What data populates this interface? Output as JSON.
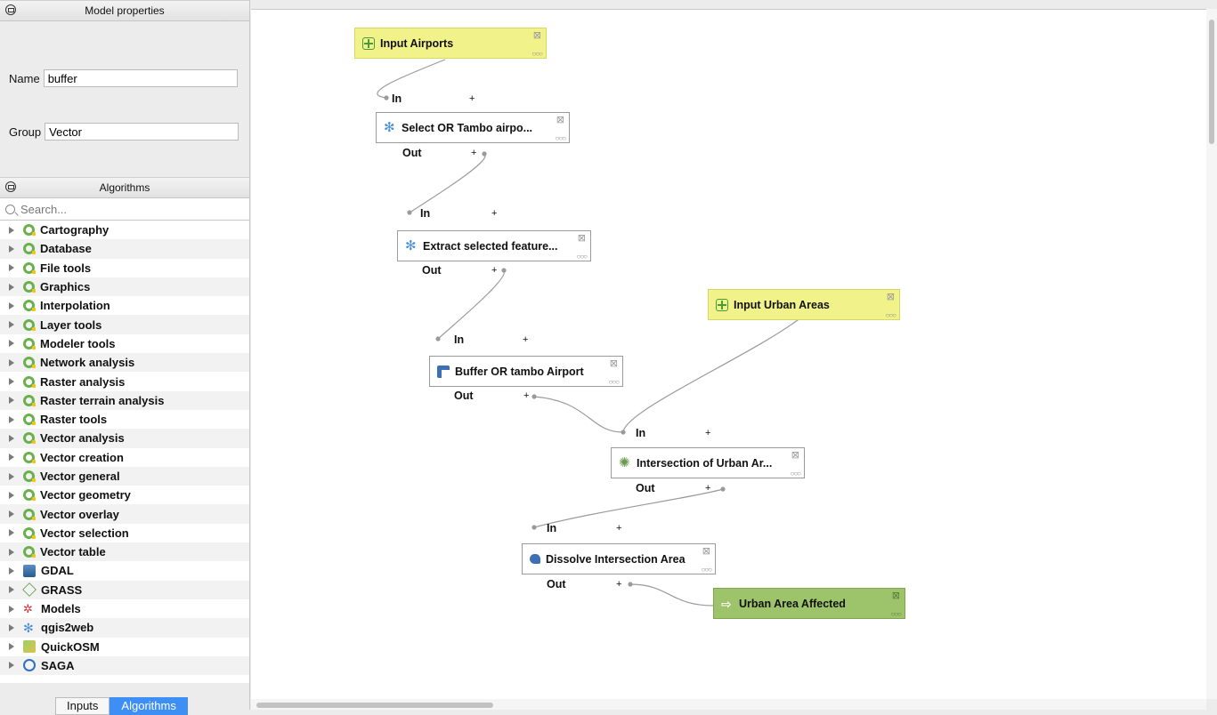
{
  "properties_panel": {
    "title": "Model properties",
    "name_label": "Name",
    "name_value": "buffer",
    "group_label": "Group",
    "group_value": "Vector"
  },
  "algorithms_panel": {
    "title": "Algorithms",
    "search_placeholder": "Search...",
    "items": [
      {
        "label": "Cartography",
        "icon": "qgis-icon"
      },
      {
        "label": "Database",
        "icon": "qgis-icon"
      },
      {
        "label": "File tools",
        "icon": "qgis-icon"
      },
      {
        "label": "Graphics",
        "icon": "qgis-icon"
      },
      {
        "label": "Interpolation",
        "icon": "qgis-icon"
      },
      {
        "label": "Layer tools",
        "icon": "qgis-icon"
      },
      {
        "label": "Modeler tools",
        "icon": "qgis-icon"
      },
      {
        "label": "Network analysis",
        "icon": "qgis-icon"
      },
      {
        "label": "Raster analysis",
        "icon": "qgis-icon"
      },
      {
        "label": "Raster terrain analysis",
        "icon": "qgis-icon"
      },
      {
        "label": "Raster tools",
        "icon": "qgis-icon"
      },
      {
        "label": "Vector analysis",
        "icon": "qgis-icon"
      },
      {
        "label": "Vector creation",
        "icon": "qgis-icon"
      },
      {
        "label": "Vector general",
        "icon": "qgis-icon"
      },
      {
        "label": "Vector geometry",
        "icon": "qgis-icon"
      },
      {
        "label": "Vector overlay",
        "icon": "qgis-icon"
      },
      {
        "label": "Vector selection",
        "icon": "qgis-icon"
      },
      {
        "label": "Vector table",
        "icon": "qgis-icon"
      },
      {
        "label": "GDAL",
        "icon": "gdal-icon"
      },
      {
        "label": "GRASS",
        "icon": "grass-icon"
      },
      {
        "label": "Models",
        "icon": "models-icon"
      },
      {
        "label": "qgis2web",
        "icon": "gear-icon"
      },
      {
        "label": "QuickOSM",
        "icon": "quickosm-icon"
      },
      {
        "label": "SAGA",
        "icon": "saga-icon"
      }
    ]
  },
  "bottom_tabs": [
    "Inputs",
    "Algorithms"
  ],
  "canvas": {
    "ports": {
      "in": "In",
      "out": "Out",
      "plus": "+"
    },
    "nodes": {
      "input_airports": "Input Airports",
      "select_or_tambo": "Select OR Tambo airpo...",
      "extract_selected": "Extract selected feature...",
      "input_urban": "Input Urban Areas",
      "buffer": "Buffer OR tambo Airport",
      "intersection": "Intersection of Urban Ar...",
      "dissolve": "Dissolve Intersection Area",
      "output": "Urban Area Affected"
    }
  }
}
